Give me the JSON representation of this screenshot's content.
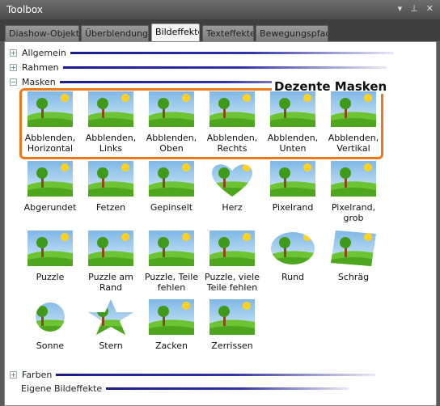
{
  "window": {
    "title": "Toolbox",
    "controls": [
      "▾",
      "⊥",
      "✕"
    ]
  },
  "tabs": [
    {
      "label": "Diashow-Objekte",
      "active": false
    },
    {
      "label": "Überblendungen",
      "active": false
    },
    {
      "label": "Bildeffekte",
      "active": true
    },
    {
      "label": "Texteffekte",
      "active": false
    },
    {
      "label": "Bewegungspfade",
      "active": false
    }
  ],
  "sections": {
    "allgemein": {
      "label": "Allgemein",
      "toggle": "+"
    },
    "rahmen": {
      "label": "Rahmen",
      "toggle": "+"
    },
    "masken": {
      "label": "Masken",
      "toggle": "−"
    },
    "farben": {
      "label": "Farben",
      "toggle": "+"
    },
    "eigene": {
      "label": "Eigene Bildeffekte"
    }
  },
  "highlight": {
    "title": "Dezente Masken",
    "color": "#f07818"
  },
  "masks": [
    {
      "label": "Abblenden, Horizontal",
      "icon": "fade-horizontal-thumb"
    },
    {
      "label": "Abblenden, Links",
      "icon": "fade-left-thumb"
    },
    {
      "label": "Abblenden, Oben",
      "icon": "fade-top-thumb"
    },
    {
      "label": "Abblenden, Rechts",
      "icon": "fade-right-thumb"
    },
    {
      "label": "Abblenden, Unten",
      "icon": "fade-bottom-thumb"
    },
    {
      "label": "Abblenden, Vertikal",
      "icon": "fade-vertical-thumb"
    },
    {
      "label": "Abgerundet",
      "icon": "rounded-thumb"
    },
    {
      "label": "Fetzen",
      "icon": "shreds-thumb"
    },
    {
      "label": "Gepinselt",
      "icon": "brushed-thumb"
    },
    {
      "label": "Herz",
      "icon": "heart-thumb"
    },
    {
      "label": "Pixelrand",
      "icon": "pixel-edge-thumb"
    },
    {
      "label": "Pixelrand, grob",
      "icon": "pixel-edge-coarse-thumb"
    },
    {
      "label": "Puzzle",
      "icon": "puzzle-thumb"
    },
    {
      "label": "Puzzle am Rand",
      "icon": "puzzle-edge-thumb"
    },
    {
      "label": "Puzzle, Teile fehlen",
      "icon": "puzzle-missing-thumb"
    },
    {
      "label": "Puzzle, viele Teile fehlen",
      "icon": "puzzle-many-missing-thumb"
    },
    {
      "label": "Rund",
      "icon": "round-thumb"
    },
    {
      "label": "Schräg",
      "icon": "slanted-thumb"
    },
    {
      "label": "Sonne",
      "icon": "sun-thumb"
    },
    {
      "label": "Stern",
      "icon": "star-thumb"
    },
    {
      "label": "Zacken",
      "icon": "jagged-thumb"
    },
    {
      "label": "Zerrissen",
      "icon": "torn-thumb"
    }
  ]
}
